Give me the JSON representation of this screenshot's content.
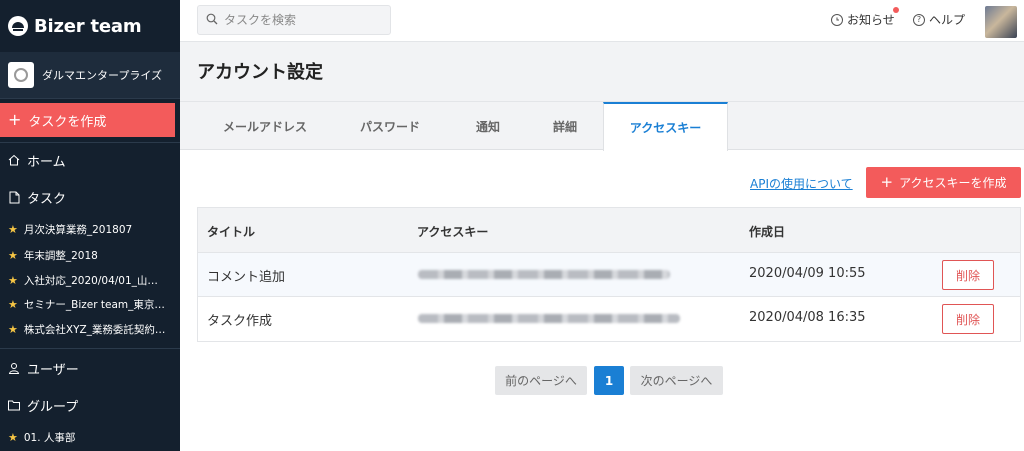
{
  "brand": {
    "name": "Bizer team"
  },
  "company": {
    "name": "ダルマエンタープライズ"
  },
  "sidebar": {
    "create_task": "タスクを作成",
    "home": "ホーム",
    "tasks": "タスク",
    "task_items": [
      "月次決算業務_201807",
      "年末調整_2018",
      "入社対応_2020/04/01_山…",
      "セミナー_Bizer team_東京…",
      "株式会社XYZ_業務委託契約…"
    ],
    "users": "ユーザー",
    "groups": "グループ",
    "group_items": [
      "01. 人事部"
    ]
  },
  "topbar": {
    "search_placeholder": "タスクを検索",
    "notice": "お知らせ",
    "help": "ヘルプ"
  },
  "page": {
    "title": "アカウント設定"
  },
  "tabs": [
    {
      "label": "メールアドレス",
      "active": false
    },
    {
      "label": "パスワード",
      "active": false
    },
    {
      "label": "通知",
      "active": false
    },
    {
      "label": "詳細",
      "active": false
    },
    {
      "label": "アクセスキー",
      "active": true
    }
  ],
  "actions": {
    "api_link": "APIの使用について",
    "add_key": "アクセスキーを作成"
  },
  "table": {
    "headers": [
      "タイトル",
      "アクセスキー",
      "作成日"
    ],
    "rows": [
      {
        "title": "コメント追加",
        "created": "2020/04/09 10:55",
        "delete": "削除"
      },
      {
        "title": "タスク作成",
        "created": "2020/04/08 16:35",
        "delete": "削除"
      }
    ]
  },
  "pagination": {
    "prev": "前のページへ",
    "current": "1",
    "next": "次のページへ"
  },
  "colors": {
    "sidebar_bg": "#14202e",
    "accent_red": "#f35b5b",
    "accent_blue": "#1a7fd4",
    "star": "#f6c544"
  }
}
